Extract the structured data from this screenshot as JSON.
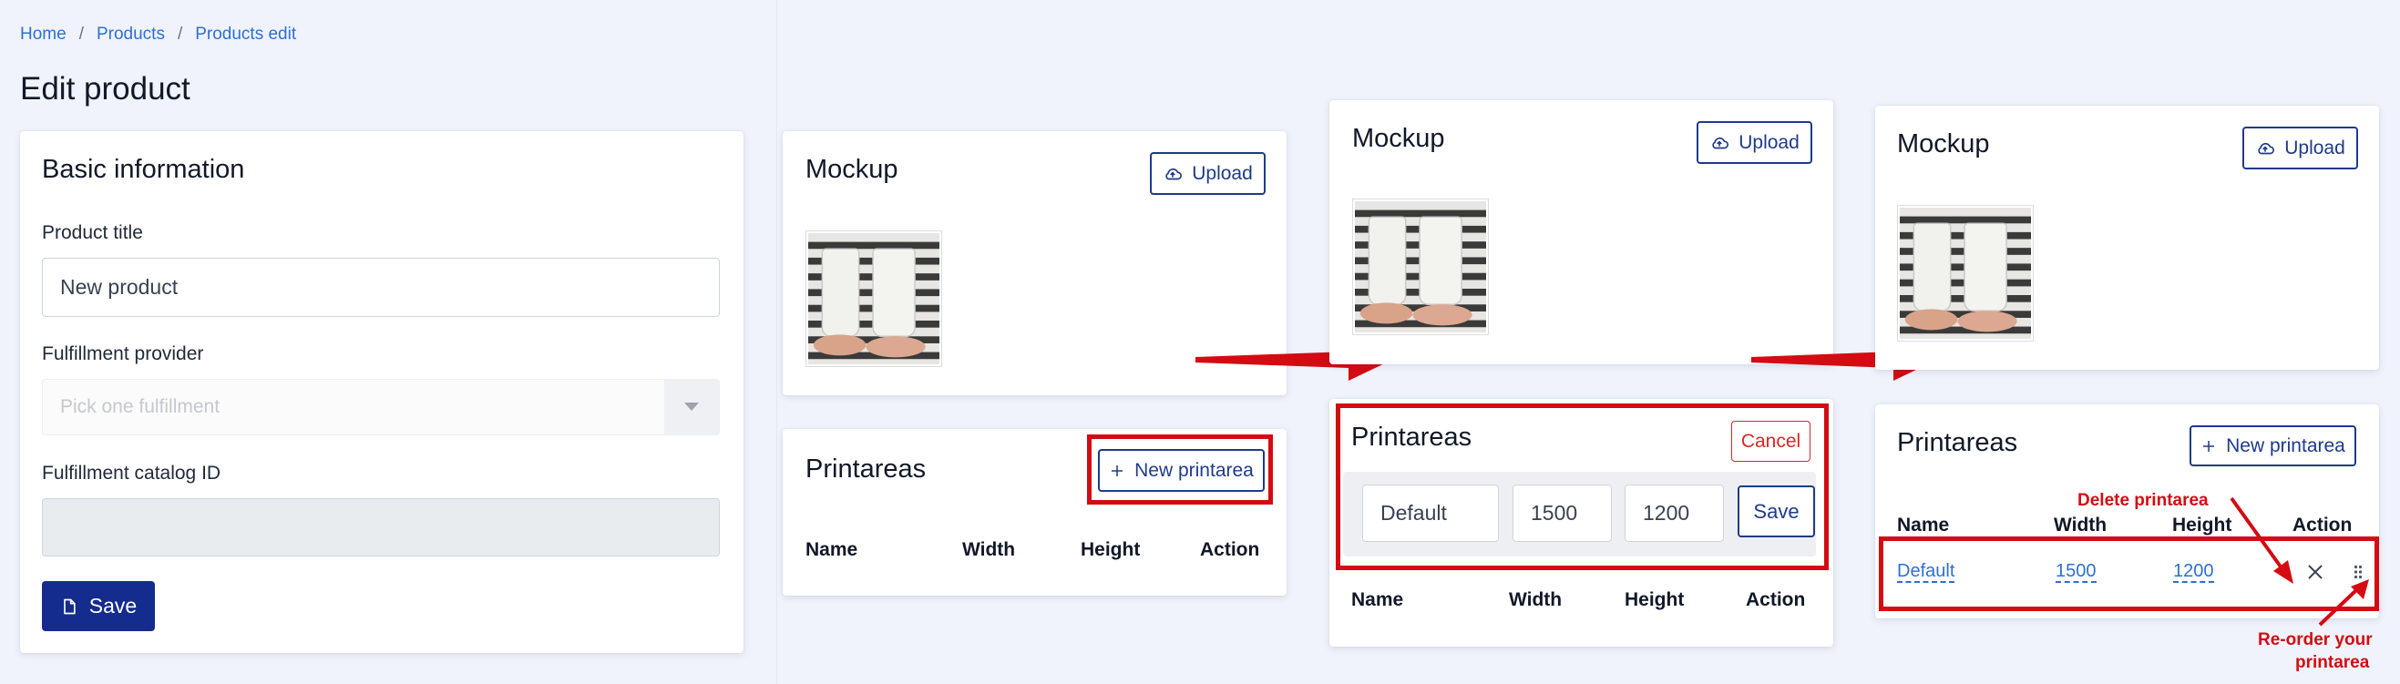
{
  "breadcrumb": [
    "Home",
    "Products",
    "Products edit"
  ],
  "page_title": "Edit product",
  "basic": {
    "title": "Basic information",
    "product_title_label": "Product title",
    "product_title_value": "New product",
    "fulfillment_label": "Fulfillment provider",
    "fulfillment_placeholder": "Pick one fulfillment",
    "catalog_label": "Fulfillment catalog ID",
    "catalog_value": "",
    "save_label": "Save"
  },
  "step1": {
    "mockup_title": "Mockup",
    "upload_label": "Upload",
    "printareas_title": "Printareas",
    "new_printarea_label": "New printarea",
    "headers": [
      "Name",
      "Width",
      "Height",
      "Action"
    ]
  },
  "step2": {
    "mockup_title": "Mockup",
    "upload_label": "Upload",
    "printareas_title": "Printareas",
    "cancel_label": "Cancel",
    "name_value": "Default",
    "width_value": "1500",
    "height_value": "1200",
    "save_label": "Save",
    "headers": [
      "Name",
      "Width",
      "Height",
      "Action"
    ]
  },
  "step3": {
    "mockup_title": "Mockup",
    "upload_label": "Upload",
    "printareas_title": "Printareas",
    "new_printarea_label": "New printarea",
    "headers": [
      "Name",
      "Width",
      "Height",
      "Action"
    ],
    "row": {
      "name": "Default",
      "width": "1500",
      "height": "1200"
    }
  },
  "annotations": {
    "delete": "Delete printarea",
    "reorder_line1": "Re-order your",
    "reorder_line2": "printarea"
  },
  "colors": {
    "background": "#f0f3fb",
    "primary": "#142c8e",
    "outline": "#1e3a8a",
    "link": "#2f6fd1",
    "annotation_red": "#d40b12",
    "danger": "#dc2626"
  },
  "icons": {
    "upload": "cloud-upload-icon",
    "plus": "plus-icon",
    "save": "file-icon",
    "delete": "close-icon",
    "reorder": "drag-handle-icon",
    "select": "caret-down-icon"
  }
}
